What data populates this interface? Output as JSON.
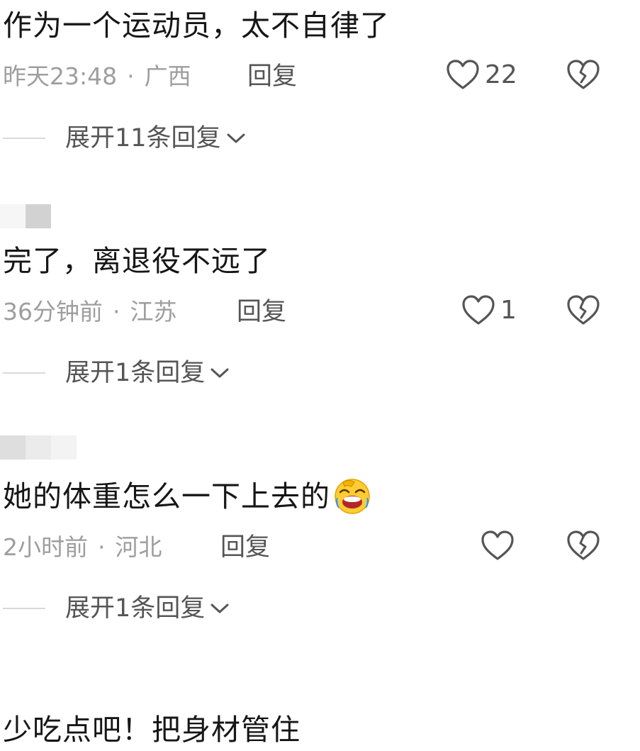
{
  "comments": [
    {
      "text": "作为一个运动员，太不自律了",
      "time": "昨天23:48",
      "location": "广西",
      "reply_label": "回复",
      "likes": "22",
      "expand_label": "展开11条回复"
    },
    {
      "text": "完了，离退役不远了",
      "time": "36分钟前",
      "location": "江苏",
      "reply_label": "回复",
      "likes": "1",
      "expand_label": "展开1条回复"
    },
    {
      "text": "她的体重怎么一下上去的",
      "emoji": "rofl-emoji",
      "time": "2小时前",
      "location": "河北",
      "reply_label": "回复",
      "likes": "",
      "expand_label": "展开1条回复"
    },
    {
      "text": "少吃点吧！把身材管住"
    }
  ],
  "separator": "·",
  "icons": {
    "like": "heart-outline-icon",
    "dislike": "broken-heart-outline-icon",
    "expand": "chevron-down-icon"
  },
  "colors": {
    "text": "#161616",
    "meta": "#9e9e9e",
    "secondary": "#555555"
  }
}
